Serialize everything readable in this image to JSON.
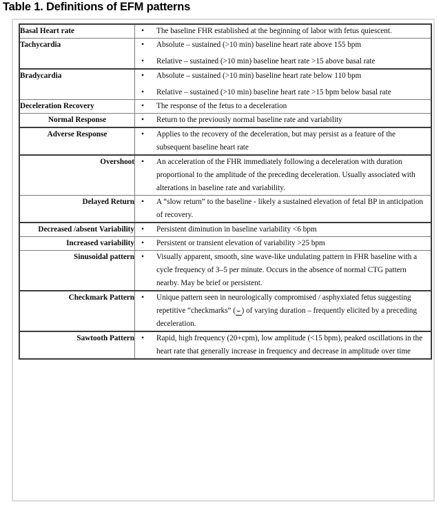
{
  "page": {
    "title": "Table 1. Definitions of EFM patterns"
  },
  "table": {
    "bullet_glyph": "•",
    "rows": [
      {
        "term": "Basal Heart rate",
        "term_align": "align-left",
        "definitions": [
          "The baseline FHR established at the beginning of labor with fetus quiescent."
        ]
      },
      {
        "term": "Tachycardia",
        "term_align": "align-left",
        "definitions": [
          "Absolute – sustained (>10 min) baseline heart rate above 155 bpm",
          "Relative – sustained (>10 min) baseline heart rate >15 above basal rate"
        ]
      },
      {
        "term": "Bradycardia",
        "term_align": "align-left",
        "definitions": [
          "Absolute – sustained (>10 min) baseline heart rate below 110 bpm",
          "Relative – sustained (>10 min) baseline heart rate >15 bpm below basal rate"
        ]
      },
      {
        "term": "Deceleration Recovery",
        "term_align": "align-left",
        "definitions": [
          "The response of the fetus to a deceleration"
        ]
      },
      {
        "term": "Normal Response",
        "term_align": "align-center",
        "definitions": [
          "Return to the previously normal baseline rate and variability"
        ]
      },
      {
        "term": "Adverse Response",
        "term_align": "align-center",
        "definitions": [
          "Applies to the recovery of the deceleration, but may persist as a feature of the subsequent baseline heart rate"
        ]
      },
      {
        "term": "Overshoot",
        "term_align": "align-right",
        "definitions": [
          "An acceleration of the FHR immediately following a deceleration with duration proportional to the amplitude of the preceding deceleration. Usually associated with alterations in baseline rate and variability."
        ]
      },
      {
        "term": "Delayed Return",
        "term_align": "align-right",
        "definitions": [
          "A “slow return” to the baseline - likely a sustained elevation of fetal BP in anticipation of recovery."
        ]
      },
      {
        "term": "Decreased /absent Variability",
        "term_align": "align-right",
        "definitions": [
          "Persistent diminution in baseline variability <6 bpm"
        ]
      },
      {
        "term": "Increased variability",
        "term_align": "align-right",
        "definitions": [
          "Persistent or transient elevation of variability >25 bpm"
        ]
      },
      {
        "term": "Sinusoidal pattern",
        "term_align": "align-right",
        "definitions": [
          "Visually apparent, smooth, sine wave-like undulating pattern in FHR baseline with a cycle frequency of 3–5 per minute. Occurs in the absence of normal CTG pattern nearby. May be brief or persistent."
        ]
      },
      {
        "term": "Checkmark Pattern",
        "term_align": "align-right",
        "definitions": [
          "Unique pattern seen in neurologically compromised / asphyxiated fetus suggesting repetitive “checkmarks” (⌣) of varying duration – frequently elicited by a preceding deceleration."
        ]
      },
      {
        "term": "Sawtooth Pattern",
        "term_align": "align-right",
        "definitions": [
          "Rapid, high frequency (20+cpm), low amplitude (<15 bpm), peaked oscillations in the heart rate that generally increase in frequency and decrease in amplitude over time"
        ]
      }
    ]
  }
}
